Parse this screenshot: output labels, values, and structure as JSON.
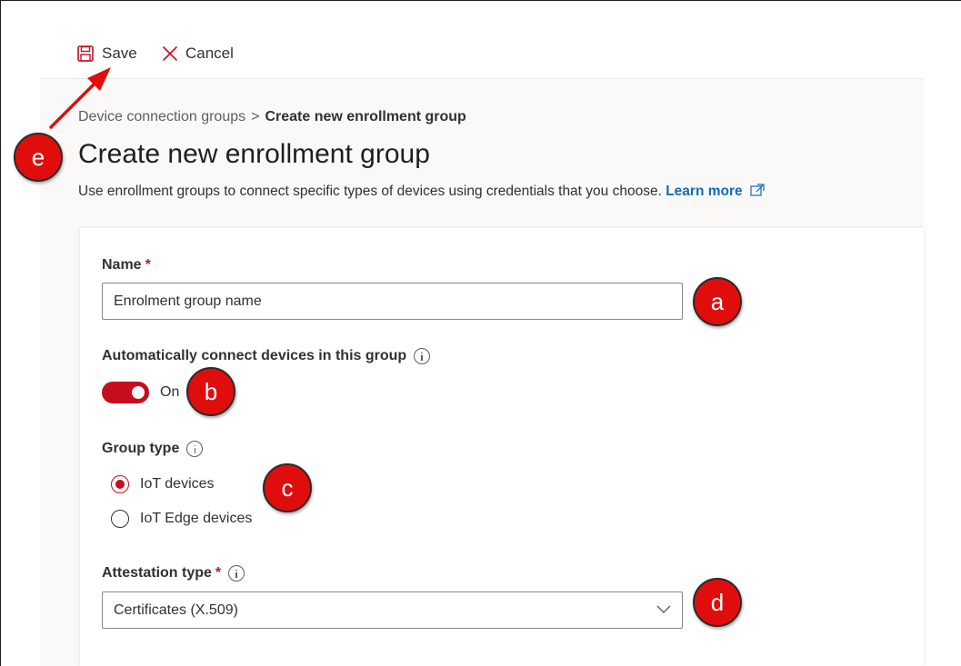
{
  "toolbar": {
    "save_label": "Save",
    "cancel_label": "Cancel"
  },
  "breadcrumb": {
    "parent": "Device connection groups",
    "separator": ">",
    "current": "Create new enrollment group"
  },
  "page": {
    "title": "Create new enrollment group",
    "description": "Use enrollment groups to connect specific types of devices using credentials that you choose.",
    "learn_more": "Learn more"
  },
  "form": {
    "name": {
      "label": "Name",
      "required_mark": "*",
      "placeholder": "Enrolment group name"
    },
    "auto_connect": {
      "label": "Automatically connect devices in this group",
      "state_text": "On",
      "value": true
    },
    "group_type": {
      "label": "Group type",
      "options": [
        {
          "label": "IoT devices",
          "selected": true
        },
        {
          "label": "IoT Edge devices",
          "selected": false
        }
      ]
    },
    "attestation_type": {
      "label": "Attestation type",
      "required_mark": "*",
      "selected": "Certificates (X.509)"
    }
  },
  "callouts": {
    "a": "a",
    "b": "b",
    "c": "c",
    "d": "d",
    "e": "e"
  },
  "colors": {
    "accent": "#c50f1f",
    "link": "#0f6cbd",
    "callout": "#e00d0d"
  }
}
